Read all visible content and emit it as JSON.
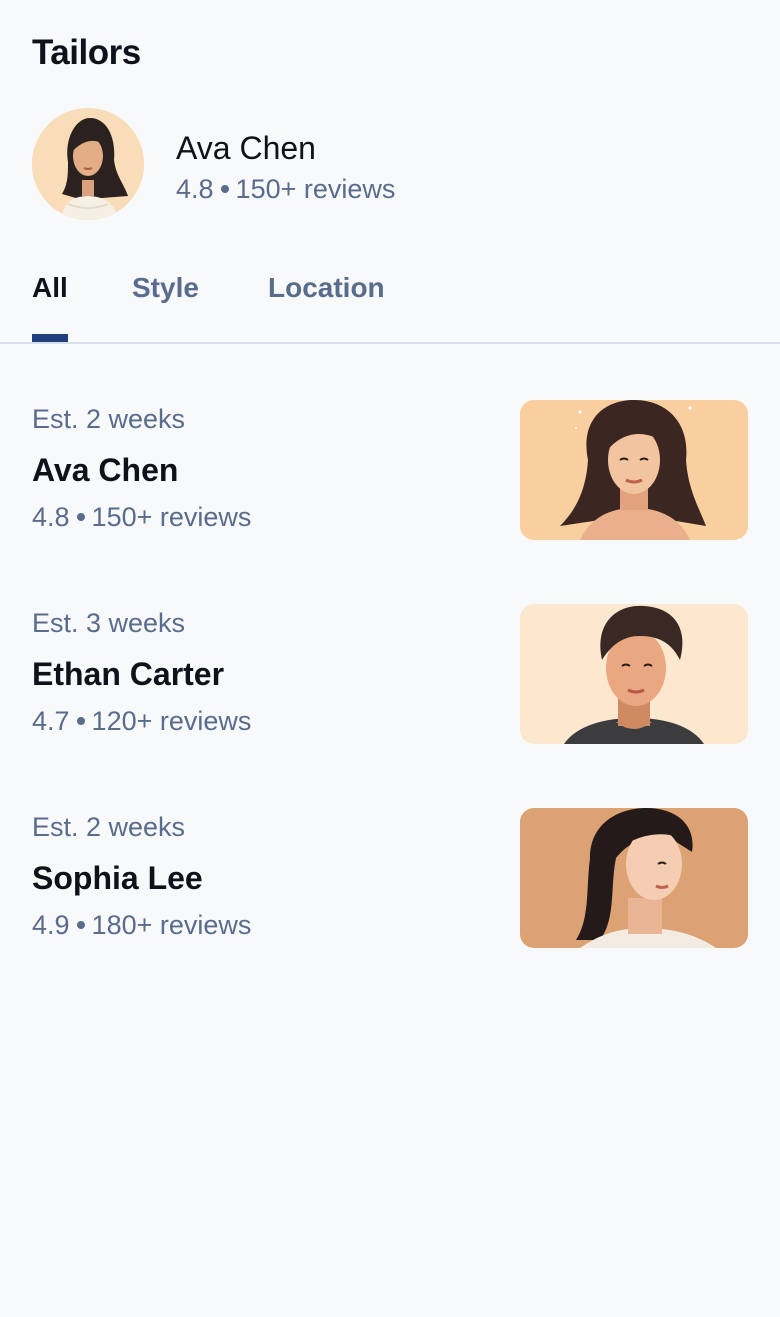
{
  "header": {
    "title": "Tailors"
  },
  "featured": {
    "name": "Ava Chen",
    "rating": "4.8",
    "reviews": "150+ reviews"
  },
  "tabs": [
    {
      "label": "All",
      "active": true
    },
    {
      "label": "Style",
      "active": false
    },
    {
      "label": "Location",
      "active": false
    }
  ],
  "tailors": [
    {
      "estimate": "Est. 2 weeks",
      "name": "Ava Chen",
      "rating": "4.8",
      "reviews": "150+ reviews",
      "image_bg": "#f9cfa0"
    },
    {
      "estimate": "Est. 3 weeks",
      "name": "Ethan Carter",
      "rating": "4.7",
      "reviews": "120+ reviews",
      "image_bg": "#fbe8cf"
    },
    {
      "estimate": "Est. 2 weeks",
      "name": "Sophia Lee",
      "rating": "4.9",
      "reviews": "180+ reviews",
      "image_bg": "#dca274"
    }
  ],
  "colors": {
    "accent": "#1f3f7e",
    "text_primary": "#0e121b",
    "text_secondary": "#5a6c8c",
    "background": "#f8f9fb"
  }
}
